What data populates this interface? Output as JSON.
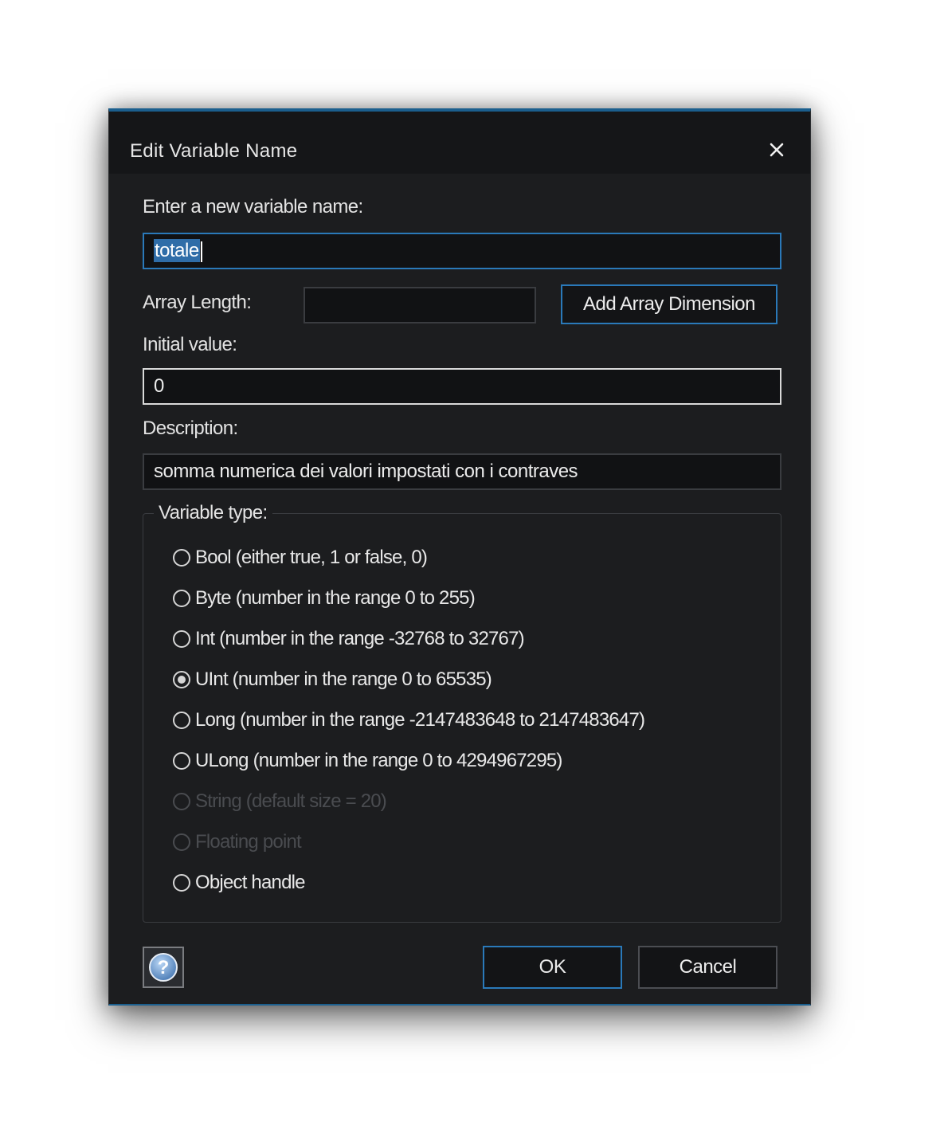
{
  "dialog": {
    "title": "Edit Variable Name",
    "close_icon": "close-icon"
  },
  "name": {
    "label": "Enter a new variable name:",
    "value": "totale"
  },
  "array": {
    "label": "Array Length:",
    "value": "",
    "add_button": "Add Array Dimension"
  },
  "initial": {
    "label": "Initial value:",
    "value": "0"
  },
  "description": {
    "label": "Description:",
    "value": "somma numerica dei valori impostati con i contraves"
  },
  "variable_type": {
    "legend": "Variable type:",
    "selected": "UInt",
    "options": [
      {
        "label": "Bool (either true, 1 or false, 0)",
        "checked": false,
        "disabled": false
      },
      {
        "label": "Byte (number in the range 0 to 255)",
        "checked": false,
        "disabled": false
      },
      {
        "label": "Int (number in the range -32768 to 32767)",
        "checked": false,
        "disabled": false
      },
      {
        "label": "UInt (number in the range 0 to 65535)",
        "checked": true,
        "disabled": false
      },
      {
        "label": "Long (number in the range -2147483648 to 2147483647)",
        "checked": false,
        "disabled": false
      },
      {
        "label": "ULong (number in the range 0 to 4294967295)",
        "checked": false,
        "disabled": false
      },
      {
        "label": "String (default size = 20)",
        "checked": false,
        "disabled": true
      },
      {
        "label": "Floating point",
        "checked": false,
        "disabled": true
      },
      {
        "label": "Object handle",
        "checked": false,
        "disabled": false
      }
    ]
  },
  "footer": {
    "help_icon": "help-icon",
    "ok": "OK",
    "cancel": "Cancel"
  },
  "colors": {
    "background": "#1c1d1f",
    "accent": "#2a79b9",
    "text": "#e8e8e8",
    "disabled_text": "#4a4c50",
    "selection": "#2f6da8"
  }
}
